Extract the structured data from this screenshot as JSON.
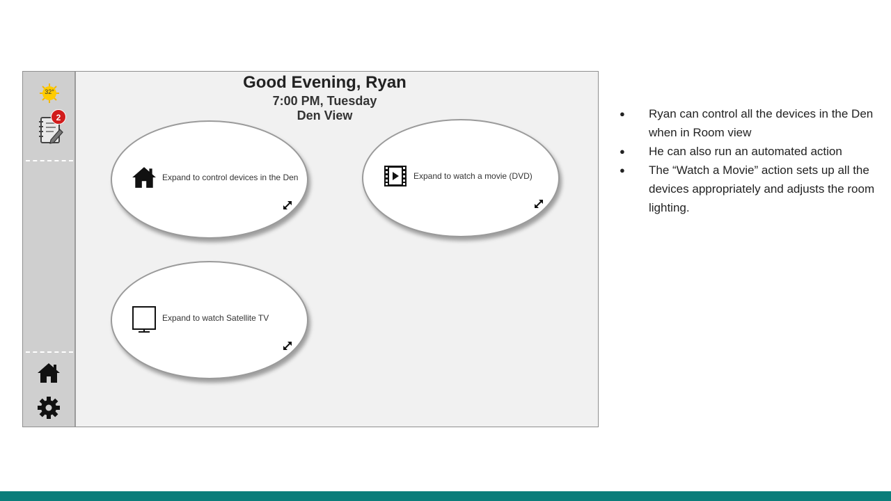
{
  "sidebar": {
    "weather_temp": "32°",
    "notification_count": "2"
  },
  "header": {
    "greeting": "Good Evening, Ryan",
    "time": "7:00 PM, Tuesday",
    "view": "Den View"
  },
  "tiles": [
    {
      "label": "Expand to control devices in the Den",
      "icon": "home-icon"
    },
    {
      "label": "Expand to watch a movie (DVD)",
      "icon": "movie-icon"
    },
    {
      "label": "Expand to watch Satellite TV",
      "icon": "tv-icon"
    }
  ],
  "notes": [
    "Ryan can control all the devices in the Den when in Room view",
    "He can also run an automated action",
    "The “Watch a Movie” action sets up all the devices appropriately and adjusts the room lighting."
  ],
  "colors": {
    "accent_bar": "#0b7d7a",
    "badge": "#d11c1c",
    "sidebar": "#cfcfcf",
    "panel": "#f1f1f1"
  }
}
